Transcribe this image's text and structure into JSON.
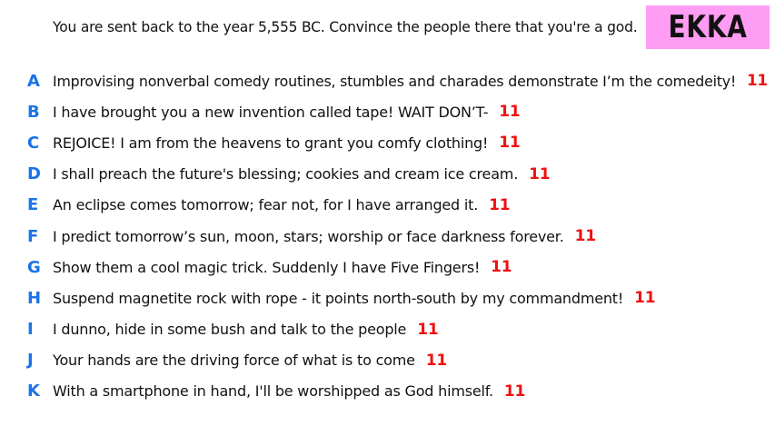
{
  "question": "You are sent back to the year 5,555 BC. Convince the people there that you're a god.",
  "player": "EKKA",
  "colors": {
    "letter": "#1a73e8",
    "score": "#ee1111",
    "badge": "#ff9cf3"
  },
  "answers": [
    {
      "letter": "A",
      "text": "Improvising nonverbal comedy routines, stumbles and charades demonstrate I’m the comedeity!",
      "score": "11"
    },
    {
      "letter": "B",
      "text": "I have brought you a new invention called tape! WAIT DON’T-",
      "score": "11"
    },
    {
      "letter": "C",
      "text": "REJOICE! I am from the heavens to grant you comfy clothing!",
      "score": "11"
    },
    {
      "letter": "D",
      "text": "I shall preach the future's blessing; cookies and cream ice cream.",
      "score": "11"
    },
    {
      "letter": "E",
      "text": "An eclipse comes tomorrow; fear not, for I have arranged it.",
      "score": "11"
    },
    {
      "letter": "F",
      "text": "I predict tomorrow’s sun, moon, stars; worship or face darkness forever.",
      "score": "11"
    },
    {
      "letter": "G",
      "text": "Show them a cool magic trick. Suddenly I have Five Fingers!",
      "score": "11"
    },
    {
      "letter": "H",
      "text": "Suspend magnetite rock with rope - it points north-south by my commandment!",
      "score": "11"
    },
    {
      "letter": "I",
      "text": "I dunno, hide in some bush and talk to the people",
      "score": "11"
    },
    {
      "letter": "J",
      "text": "Your hands are the driving force of what is to come",
      "score": "11"
    },
    {
      "letter": "K",
      "text": "With a smartphone in hand, I'll be worshipped as God himself.",
      "score": "11"
    }
  ]
}
